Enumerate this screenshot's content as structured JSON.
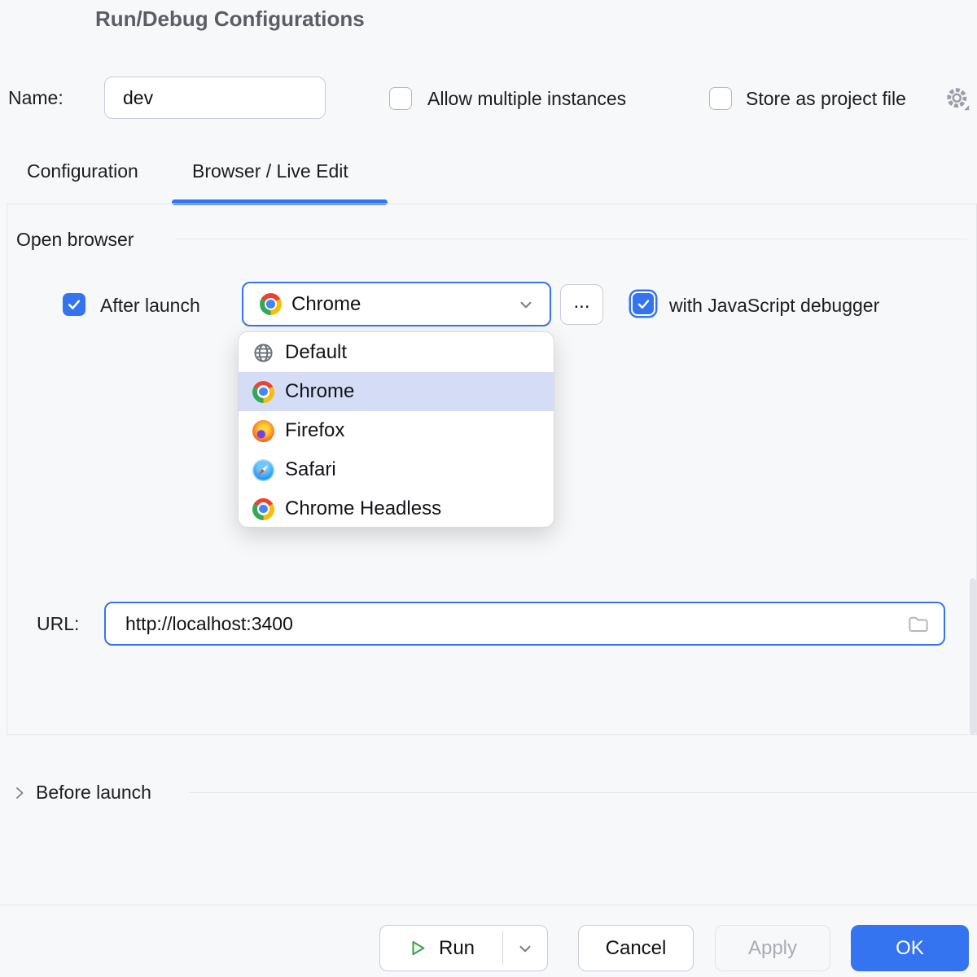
{
  "window": {
    "title": "Run/Debug Configurations"
  },
  "accent_color": "#3574F0",
  "selection_color": "#D5DCF5",
  "name_row": {
    "label": "Name:",
    "value": "dev",
    "allow_multiple": {
      "label": "Allow multiple instances",
      "checked": false
    },
    "store_as_project": {
      "label": "Store as project file",
      "checked": false
    },
    "gear_icon": "gear-icon"
  },
  "tabs": {
    "items": [
      {
        "label": "Configuration",
        "active": false
      },
      {
        "label": "Browser / Live Edit",
        "active": true
      }
    ]
  },
  "open_browser": {
    "section_label": "Open browser",
    "after_launch": {
      "label": "After launch",
      "checked": true
    },
    "browser_select": {
      "value": "Chrome",
      "icon": "chrome-icon"
    },
    "more_button_label": "...",
    "js_debugger": {
      "label": "with JavaScript debugger",
      "checked": true
    },
    "dropdown": {
      "items": [
        {
          "label": "Default",
          "icon": "globe-icon",
          "selected": false
        },
        {
          "label": "Chrome",
          "icon": "chrome-icon",
          "selected": true
        },
        {
          "label": "Firefox",
          "icon": "firefox-icon",
          "selected": false
        },
        {
          "label": "Safari",
          "icon": "safari-icon",
          "selected": false
        },
        {
          "label": "Chrome Headless",
          "icon": "chrome-icon",
          "selected": false
        }
      ]
    },
    "url": {
      "label": "URL:",
      "value": "http://localhost:3400",
      "folder_icon": "folder-icon"
    }
  },
  "before_launch": {
    "label": "Before launch",
    "collapsed": true
  },
  "footer": {
    "run_label": "Run",
    "cancel_label": "Cancel",
    "apply_label": "Apply",
    "apply_enabled": false,
    "ok_label": "OK"
  }
}
